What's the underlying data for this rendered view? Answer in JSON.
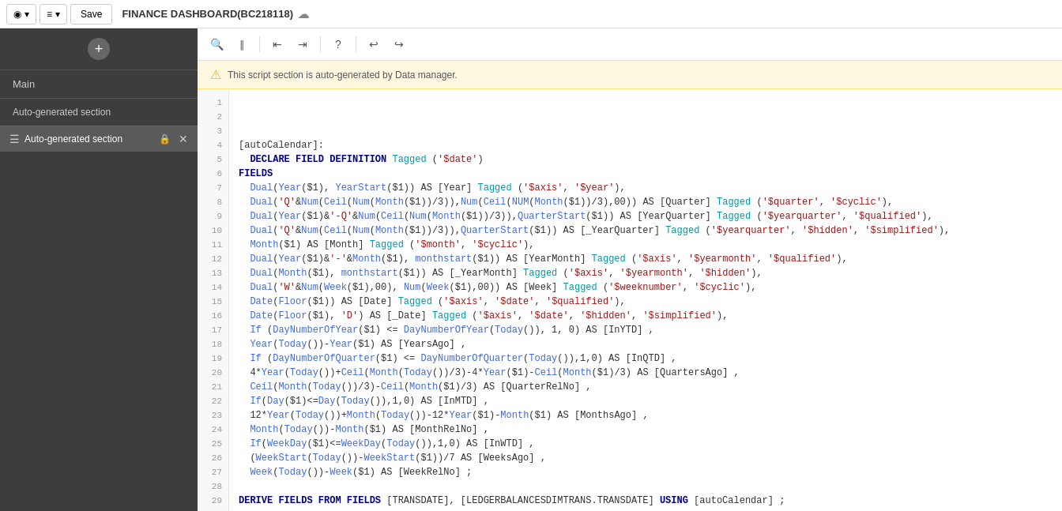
{
  "topbar": {
    "btn1_label": "◉",
    "btn2_label": "≡",
    "save_label": "Save",
    "title": "FINANCE DASHBOARD(BC218118)",
    "cloud_icon": "☁"
  },
  "sidebar": {
    "add_icon": "+",
    "main_label": "Main",
    "auto_section_label": "Auto-generated section",
    "active_section_label": "Auto-generated section",
    "menu_icon": "☰",
    "lock_icon": "🔒",
    "close_icon": "✕"
  },
  "editor_toolbar": {
    "search_icon": "🔍",
    "edit_icon": "✏",
    "unindent_icon": "⇤",
    "indent_icon": "⇥",
    "help_icon": "?",
    "undo_icon": "↩",
    "redo_icon": "↪"
  },
  "warning": {
    "icon": "⚠",
    "text": "This script section is auto-generated by Data manager."
  },
  "line_numbers": [
    1,
    2,
    3,
    4,
    5,
    6,
    7,
    8,
    9,
    10,
    11,
    12,
    13,
    14,
    15,
    16,
    17,
    18,
    19,
    20,
    21,
    22,
    23,
    24,
    25,
    26,
    27,
    28,
    29
  ],
  "code_lines": [
    "",
    "",
    "",
    "[autoCalendar]:",
    "  DECLARE FIELD DEFINITION Tagged ('$date')",
    "FIELDS",
    "  Dual(Year($1), YearStart($1)) AS [Year] Tagged ('$axis', '$year'),",
    "  Dual('Q'&Num(Ceil(Num(Month($1))/3)),Num(Ceil(NUM(Month($1))/3),00)) AS [Quarter] Tagged ('$quarter', '$cyclic'),",
    "  Dual(Year($1)&'-Q'&Num(Ceil(Num(Month($1))/3)),QuarterStart($1)) AS [YearQuarter] Tagged ('$yearquarter', '$qualified'),",
    "  Dual('Q'&Num(Ceil(Num(Month($1))/3)),QuarterStart($1)) AS [_YearQuarter] Tagged ('$yearquarter', '$hidden', '$simplified'),",
    "  Month($1) AS [Month] Tagged ('$month', '$cyclic'),",
    "  Dual(Year($1)&'-'&Month($1), monthstart($1)) AS [YearMonth] Tagged ('$axis', '$yearmonth', '$qualified'),",
    "  Dual(Month($1), monthstart($1)) AS [_YearMonth] Tagged ('$axis', '$yearmonth', '$hidden'),",
    "  Dual('W'&Num(Week($1),00), Num(Week($1),00)) AS [Week] Tagged ('$weeknumber', '$cyclic'),",
    "  Date(Floor($1)) AS [Date] Tagged ('$axis', '$date', '$qualified'),",
    "  Date(Floor($1), 'D') AS [_Date] Tagged ('$axis', '$date', '$hidden', '$simplified'),",
    "  If (DayNumberOfYear($1) <= DayNumberOfYear(Today()), 1, 0) AS [InYTD] ,",
    "  Year(Today())-Year($1) AS [YearsAgo] ,",
    "  If (DayNumberOfQuarter($1) <= DayNumberOfQuarter(Today()),1,0) AS [InQTD] ,",
    "  4*Year(Today())+Ceil(Month(Today())/3)-4*Year($1)-Ceil(Month($1)/3) AS [QuartersAgo] ,",
    "  Ceil(Month(Today())/3)-Ceil(Month($1)/3) AS [QuarterRelNo] ,",
    "  If(Day($1)<=Day(Today()),1,0) AS [InMTD] ,",
    "  12*Year(Today())+Month(Today())-12*Year($1)-Month($1) AS [MonthsAgo] ,",
    "  Month(Today())-Month($1) AS [MonthRelNo] ,",
    "  If(WeekDay($1)<=WeekDay(Today()),1,0) AS [InWTD] ,",
    "  (WeekStart(Today())-WeekStart($1))/7 AS [WeeksAgo] ,",
    "  Week(Today())-Week($1) AS [WeekRelNo] ;",
    "",
    "DERIVE FIELDS FROM FIELDS [TRANSDATE], [LEDGERBALANCESDIMTRANS.TRANSDATE] USING [autoCalendar] ;"
  ]
}
